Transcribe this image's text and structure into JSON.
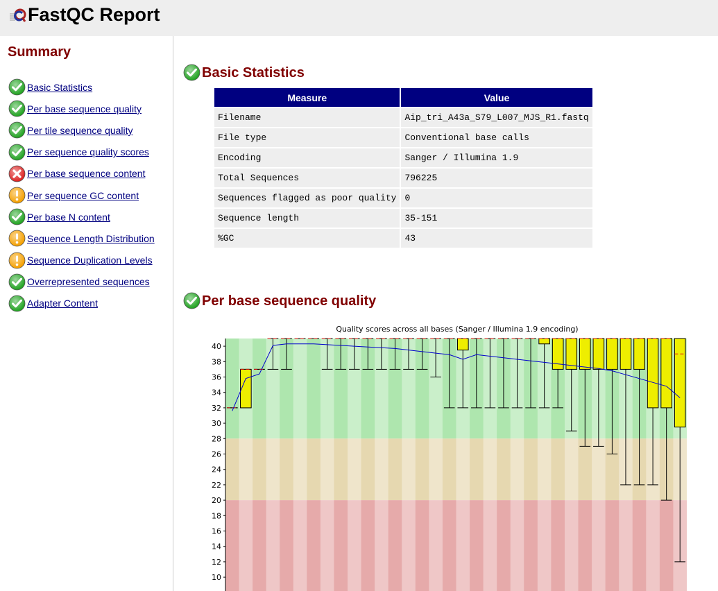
{
  "header": {
    "title": "FastQC Report",
    "logo": "fastqc-logo"
  },
  "sidebar": {
    "title": "Summary",
    "items": [
      {
        "label": "Basic Statistics",
        "status": "pass"
      },
      {
        "label": "Per base sequence quality",
        "status": "pass"
      },
      {
        "label": "Per tile sequence quality",
        "status": "pass"
      },
      {
        "label": "Per sequence quality scores",
        "status": "pass"
      },
      {
        "label": "Per base sequence content",
        "status": "fail"
      },
      {
        "label": "Per sequence GC content",
        "status": "warn"
      },
      {
        "label": "Per base N content",
        "status": "pass"
      },
      {
        "label": "Sequence Length Distribution",
        "status": "warn"
      },
      {
        "label": "Sequence Duplication Levels",
        "status": "warn"
      },
      {
        "label": "Overrepresented sequences",
        "status": "pass"
      },
      {
        "label": "Adapter Content",
        "status": "pass"
      }
    ]
  },
  "colors": {
    "pass": "#22a322",
    "fail": "#dd2222",
    "warn": "#f5a000",
    "heading": "#800000",
    "table_header": "#000080",
    "link": "#000080"
  },
  "basic_statistics": {
    "title": "Basic Statistics",
    "status": "pass",
    "columns": [
      "Measure",
      "Value"
    ],
    "rows": [
      [
        "Filename",
        "Aip_tri_A43a_S79_L007_MJS_R1.fastq"
      ],
      [
        "File type",
        "Conventional base calls"
      ],
      [
        "Encoding",
        "Sanger / Illumina 1.9"
      ],
      [
        "Total Sequences",
        "796225"
      ],
      [
        "Sequences flagged as poor quality",
        "0"
      ],
      [
        "Sequence length",
        "35-151"
      ],
      [
        "%GC",
        "43"
      ]
    ]
  },
  "per_base_quality": {
    "title": "Per base sequence quality",
    "status": "pass"
  },
  "chart_data": {
    "type": "box",
    "title": "Quality scores across all bases (Sanger / Illumina 1.9 encoding)",
    "xlabel": "",
    "ylabel": "",
    "ylim": [
      8,
      41
    ],
    "yticks": [
      10,
      12,
      14,
      16,
      18,
      20,
      22,
      24,
      26,
      28,
      30,
      32,
      34,
      36,
      38,
      40
    ],
    "zones": [
      {
        "from": 28,
        "to": 41,
        "color": "#aee6ae"
      },
      {
        "from": 20,
        "to": 28,
        "color": "#e6d8b0"
      },
      {
        "from": 8,
        "to": 20,
        "color": "#e6aaaa"
      }
    ],
    "boxes": [
      {
        "median": 32,
        "q1": 32,
        "q3": 32,
        "low": 32,
        "high": 32,
        "mean": 31.6
      },
      {
        "median": 37,
        "q1": 32,
        "q3": 37,
        "low": 32,
        "high": 37,
        "mean": 35.8
      },
      {
        "median": 37,
        "q1": 37,
        "q3": 37,
        "low": 37,
        "high": 37,
        "mean": 36.4
      },
      {
        "median": 41,
        "q1": 41,
        "q3": 41,
        "low": 37,
        "high": 41,
        "mean": 40.1
      },
      {
        "median": 41,
        "q1": 41,
        "q3": 41,
        "low": 37,
        "high": 41,
        "mean": 40.3
      },
      {
        "median": 41,
        "q1": 41,
        "q3": 41,
        "low": 41,
        "high": 41,
        "mean": 40.3
      },
      {
        "median": 41,
        "q1": 41,
        "q3": 41,
        "low": 41,
        "high": 41,
        "mean": 40.3
      },
      {
        "median": 41,
        "q1": 41,
        "q3": 41,
        "low": 37,
        "high": 41,
        "mean": 40.2
      },
      {
        "median": 41,
        "q1": 41,
        "q3": 41,
        "low": 37,
        "high": 41,
        "mean": 40.1
      },
      {
        "median": 41,
        "q1": 41,
        "q3": 41,
        "low": 37,
        "high": 41,
        "mean": 40.0
      },
      {
        "median": 41,
        "q1": 41,
        "q3": 41,
        "low": 37,
        "high": 41,
        "mean": 39.9
      },
      {
        "median": 41,
        "q1": 41,
        "q3": 41,
        "low": 37,
        "high": 41,
        "mean": 39.8
      },
      {
        "median": 41,
        "q1": 41,
        "q3": 41,
        "low": 37,
        "high": 41,
        "mean": 39.7
      },
      {
        "median": 41,
        "q1": 41,
        "q3": 41,
        "low": 37,
        "high": 41,
        "mean": 39.5
      },
      {
        "median": 41,
        "q1": 41,
        "q3": 41,
        "low": 37,
        "high": 41,
        "mean": 39.3
      },
      {
        "median": 41,
        "q1": 41,
        "q3": 41,
        "low": 36,
        "high": 41,
        "mean": 39.1
      },
      {
        "median": 41,
        "q1": 41,
        "q3": 41,
        "low": 32,
        "high": 41,
        "mean": 38.9
      },
      {
        "median": 41,
        "q1": 39.5,
        "q3": 41,
        "low": 32,
        "high": 41,
        "mean": 38.3
      },
      {
        "median": 41,
        "q1": 41,
        "q3": 41,
        "low": 32,
        "high": 41,
        "mean": 38.9
      },
      {
        "median": 41,
        "q1": 41,
        "q3": 41,
        "low": 32,
        "high": 41,
        "mean": 38.7
      },
      {
        "median": 41,
        "q1": 41,
        "q3": 41,
        "low": 32,
        "high": 41,
        "mean": 38.5
      },
      {
        "median": 41,
        "q1": 41,
        "q3": 41,
        "low": 32,
        "high": 41,
        "mean": 38.3
      },
      {
        "median": 41,
        "q1": 41,
        "q3": 41,
        "low": 32,
        "high": 41,
        "mean": 38.1
      },
      {
        "median": 41,
        "q1": 40.3,
        "q3": 41,
        "low": 32,
        "high": 41,
        "mean": 37.9
      },
      {
        "median": 41,
        "q1": 37,
        "q3": 41,
        "low": 32,
        "high": 41,
        "mean": 37.7
      },
      {
        "median": 41,
        "q1": 37,
        "q3": 41,
        "low": 29,
        "high": 41,
        "mean": 37.5
      },
      {
        "median": 41,
        "q1": 37,
        "q3": 41,
        "low": 27,
        "high": 41,
        "mean": 37.3
      },
      {
        "median": 41,
        "q1": 37,
        "q3": 41,
        "low": 27,
        "high": 41,
        "mean": 37.1
      },
      {
        "median": 41,
        "q1": 37,
        "q3": 41,
        "low": 26,
        "high": 41,
        "mean": 36.8
      },
      {
        "median": 41,
        "q1": 37,
        "q3": 41,
        "low": 22,
        "high": 41,
        "mean": 36.3
      },
      {
        "median": 41,
        "q1": 37,
        "q3": 41,
        "low": 22,
        "high": 41,
        "mean": 35.8
      },
      {
        "median": 41,
        "q1": 32,
        "q3": 41,
        "low": 22,
        "high": 41,
        "mean": 35.3
      },
      {
        "median": 41,
        "q1": 32,
        "q3": 41,
        "low": 20,
        "high": 41,
        "mean": 34.8
      },
      {
        "median": 39,
        "q1": 29.5,
        "q3": 41,
        "low": 12,
        "high": 41,
        "mean": 33.3
      }
    ]
  }
}
